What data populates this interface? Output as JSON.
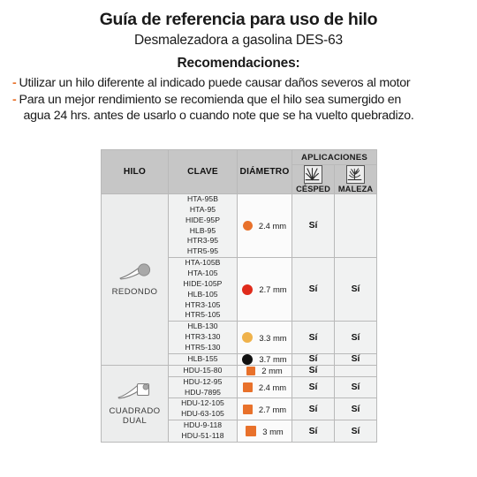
{
  "header": {
    "title": "Guía de referencia para uso de hilo",
    "subtitle": "Desmalezadora a gasolina DES-63",
    "reco_title": "Recomendaciones:",
    "bullet_mark": "-"
  },
  "recommendations": [
    {
      "line1": "Utilizar un hilo diferente al indicado puede causar daños severos al motor",
      "line2": ""
    },
    {
      "line1": "Para un mejor rendimiento se recomienda que el hilo sea sumergido en",
      "line2": "agua 24 hrs. antes de usarlo o cuando note que se ha vuelto quebradizo."
    }
  ],
  "table": {
    "columns": {
      "hilo": "HILO",
      "clave": "CLAVE",
      "diametro": "DIÁMETRO",
      "aplicaciones": "APLICACIONES",
      "cesped": "CÉSPED",
      "maleza": "MALEZA"
    },
    "icons": {
      "cesped": "grass-icon",
      "maleza": "weeds-icon",
      "redondo": "round-line-icon",
      "cuadrado_dual": "dual-square-line-icon"
    },
    "groups": [
      {
        "label": "REDONDO",
        "icon": "round-line-icon",
        "rows": [
          {
            "claves": [
              "HTA-95B",
              "HTA-95",
              "HIDE-95P",
              "HLB-95",
              "HTR3-95",
              "HTR5-95"
            ],
            "diametro": "2.4 mm",
            "shape": "circle",
            "color": "#e8712b",
            "size": 11,
            "cesped": "Sí",
            "maleza": ""
          },
          {
            "claves": [
              "HTA-105B",
              "HTA-105",
              "HIDE-105P",
              "HLB-105",
              "HTR3-105",
              "HTR5-105"
            ],
            "diametro": "2.7 mm",
            "shape": "circle",
            "color": "#e02b1b",
            "size": 12,
            "cesped": "Sí",
            "maleza": "Sí"
          },
          {
            "claves": [
              "HLB-130",
              "HTR3-130",
              "HTR5-130"
            ],
            "diametro": "3.3 mm",
            "shape": "circle",
            "color": "#efb24b",
            "size": 12,
            "cesped": "Sí",
            "maleza": "Sí"
          },
          {
            "claves": [
              "HLB-155"
            ],
            "diametro": "3.7 mm",
            "shape": "circle",
            "color": "#111111",
            "size": 12,
            "cesped": "Sí",
            "maleza": "Sí"
          }
        ]
      },
      {
        "label": "CUADRADO DUAL",
        "icon": "dual-square-line-icon",
        "rows": [
          {
            "claves": [
              "HDU-15-80"
            ],
            "diametro": "2 mm",
            "shape": "square",
            "color": "#e8712b",
            "size": 10,
            "cesped": "Sí",
            "maleza": ""
          },
          {
            "claves": [
              "HDU-12-95",
              "HDU-7895"
            ],
            "diametro": "2.4 mm",
            "shape": "square",
            "color": "#e8712b",
            "size": 11,
            "cesped": "Sí",
            "maleza": "Sí"
          },
          {
            "claves": [
              "HDU-12-105",
              "HDU-63-105"
            ],
            "diametro": "2.7 mm",
            "shape": "square",
            "color": "#e8712b",
            "size": 11,
            "cesped": "Sí",
            "maleza": "Sí"
          },
          {
            "claves": [
              "HDU-9-118",
              "HDU-51-118"
            ],
            "diametro": "3 mm",
            "shape": "square",
            "color": "#e8712b",
            "size": 12,
            "cesped": "Sí",
            "maleza": "Sí"
          }
        ]
      }
    ]
  },
  "colors": {
    "accent": "#e8712b",
    "header_fill": "#c6c6c6",
    "group_fill": "#eceded",
    "cell_fill": "#f1f2f2",
    "border": "#b9b9b9"
  }
}
